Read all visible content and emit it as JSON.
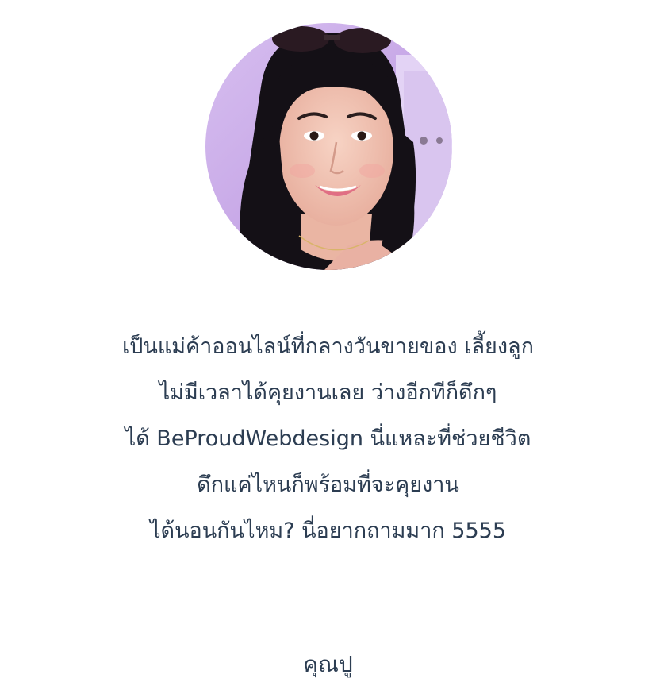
{
  "testimonial": {
    "lines": [
      "เป็นแม่ค้าออนไลน์ที่กลางวันขายของ เลี้ยงลูก",
      "ไม่มีเวลาได้คุยงานเลย ว่างอีกทีก็ดึกๆ",
      "ได้ BeProudWebdesign นี่แหละที่ช่วยชีวิต",
      "ดึกแค่ไหนก็พร้อมที่จะคุยงาน",
      "ได้นอนกันไหม? นี่อยากถามมาก 5555"
    ]
  },
  "author": {
    "name": "คุณปู"
  },
  "avatar": {
    "icon": "profile-photo",
    "colors": {
      "background": "#c6a6e6",
      "hair": "#141016",
      "skin": "#f2c3b0",
      "lips": "#e06f84"
    }
  }
}
